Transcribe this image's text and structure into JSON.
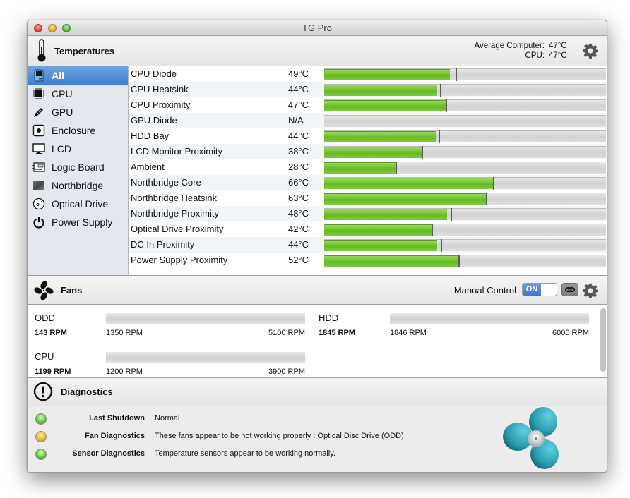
{
  "window": {
    "title": "TG Pro"
  },
  "temperatures": {
    "title": "Temperatures",
    "average_label": "Average Computer:",
    "average_value": "47°C",
    "cpu_label": "CPU:",
    "cpu_value": "47°C"
  },
  "sidebar": {
    "items": [
      {
        "label": "All",
        "icon": "computer-icon",
        "active": true
      },
      {
        "label": "CPU",
        "icon": "cpu-chip-icon",
        "active": false
      },
      {
        "label": "GPU",
        "icon": "gpu-pencil-icon",
        "active": false
      },
      {
        "label": "Enclosure",
        "icon": "enclosure-icon",
        "active": false
      },
      {
        "label": "LCD",
        "icon": "monitor-icon",
        "active": false
      },
      {
        "label": "Logic Board",
        "icon": "logic-board-icon",
        "active": false
      },
      {
        "label": "Northbridge",
        "icon": "northbridge-icon",
        "active": false
      },
      {
        "label": "Optical Drive",
        "icon": "optical-drive-icon",
        "active": false
      },
      {
        "label": "Power Supply",
        "icon": "power-icon",
        "active": false
      }
    ]
  },
  "sensors": [
    {
      "name": "CPU Diode",
      "value": "49°C",
      "fill": 0.445,
      "max": 0.465
    },
    {
      "name": "CPU Heatsink",
      "value": "44°C",
      "fill": 0.4,
      "max": 0.41
    },
    {
      "name": "CPU Proximity",
      "value": "47°C",
      "fill": 0.43,
      "max": 0.43
    },
    {
      "name": "GPU Diode",
      "value": "N/A",
      "fill": 0,
      "max": null
    },
    {
      "name": "HDD Bay",
      "value": "44°C",
      "fill": 0.397,
      "max": 0.405
    },
    {
      "name": "LCD Monitor Proximity",
      "value": "38°C",
      "fill": 0.346,
      "max": 0.346
    },
    {
      "name": "Ambient",
      "value": "28°C",
      "fill": 0.254,
      "max": 0.254
    },
    {
      "name": "Northbridge Core",
      "value": "66°C",
      "fill": 0.6,
      "max": 0.6
    },
    {
      "name": "Northbridge Heatsink",
      "value": "63°C",
      "fill": 0.573,
      "max": 0.573
    },
    {
      "name": "Northbridge Proximity",
      "value": "48°C",
      "fill": 0.435,
      "max": 0.448
    },
    {
      "name": "Optical Drive Proximity",
      "value": "42°C",
      "fill": 0.381,
      "max": 0.381
    },
    {
      "name": "DC In Proximity",
      "value": "44°C",
      "fill": 0.4,
      "max": 0.413
    },
    {
      "name": "Power Supply Proximity",
      "value": "52°C",
      "fill": 0.477,
      "max": 0.477
    }
  ],
  "fans": {
    "title": "Fans",
    "manual_control_label": "Manual Control",
    "toggle_label": "ON",
    "toggle_on": true,
    "items": [
      {
        "name": "ODD",
        "current": "143 RPM",
        "min": "1350 RPM",
        "max": "5100 RPM"
      },
      {
        "name": "HDD",
        "current": "1845 RPM",
        "min": "1846 RPM",
        "max": "6000 RPM"
      },
      {
        "name": "CPU",
        "current": "1199 RPM",
        "min": "1200 RPM",
        "max": "3900 RPM"
      }
    ]
  },
  "diagnostics": {
    "title": "Diagnostics",
    "rows": [
      {
        "label": "Last Shutdown",
        "text": "Normal",
        "status": "green"
      },
      {
        "label": "Fan Diagnostics",
        "text": "These fans appear to be not working properly : Optical Disc Drive (ODD)",
        "status": "orange"
      },
      {
        "label": "Sensor Diagnostics",
        "text": "Temperature sensors appear to be working normally.",
        "status": "green"
      }
    ]
  },
  "colors": {
    "accent_blue": "#3d7ed0",
    "bar_green": "#6fc02e",
    "logo_teal": "#2a9bb0"
  }
}
